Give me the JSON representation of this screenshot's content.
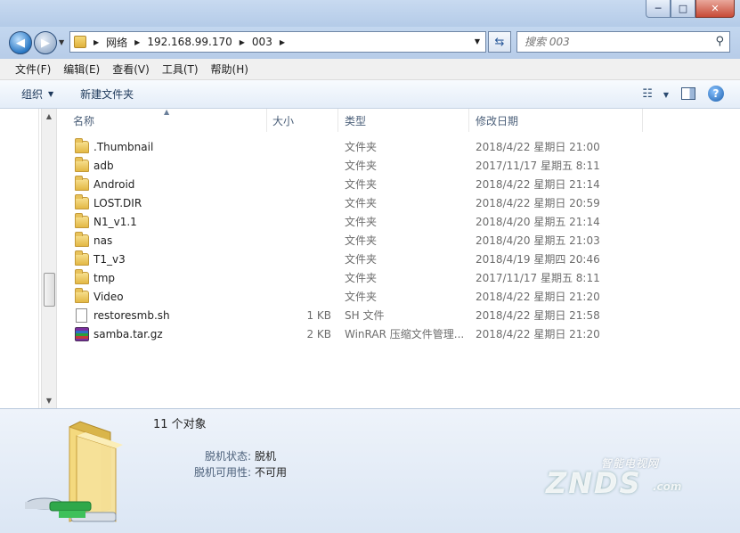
{
  "window": {
    "minimize_glyph": "─",
    "maximize_glyph": "□",
    "close_glyph": "✕"
  },
  "address": {
    "crumbs": [
      "网络",
      "192.168.99.170",
      "003"
    ]
  },
  "search": {
    "placeholder": "搜索 003"
  },
  "menu": [
    "文件(F)",
    "编辑(E)",
    "查看(V)",
    "工具(T)",
    "帮助(H)"
  ],
  "toolbar": {
    "organize": "组织",
    "new_folder": "新建文件夹"
  },
  "columns": {
    "name": "名称",
    "size": "大小",
    "type": "类型",
    "date": "修改日期"
  },
  "files": [
    {
      "name": ".Thumbnail",
      "size": "",
      "type": "文件夹",
      "date": "2018/4/22 星期日 21:00",
      "icon": "folder-icon"
    },
    {
      "name": "adb",
      "size": "",
      "type": "文件夹",
      "date": "2017/11/17 星期五 8:11",
      "icon": "folder-icon"
    },
    {
      "name": "Android",
      "size": "",
      "type": "文件夹",
      "date": "2018/4/22 星期日 21:14",
      "icon": "folder-icon"
    },
    {
      "name": "LOST.DIR",
      "size": "",
      "type": "文件夹",
      "date": "2018/4/22 星期日 20:59",
      "icon": "folder-icon"
    },
    {
      "name": "N1_v1.1",
      "size": "",
      "type": "文件夹",
      "date": "2018/4/20 星期五 21:14",
      "icon": "folder-icon"
    },
    {
      "name": "nas",
      "size": "",
      "type": "文件夹",
      "date": "2018/4/20 星期五 21:03",
      "icon": "folder-icon"
    },
    {
      "name": "T1_v3",
      "size": "",
      "type": "文件夹",
      "date": "2018/4/19 星期四 20:46",
      "icon": "folder-icon"
    },
    {
      "name": "tmp",
      "size": "",
      "type": "文件夹",
      "date": "2017/11/17 星期五 8:11",
      "icon": "folder-icon"
    },
    {
      "name": "Video",
      "size": "",
      "type": "文件夹",
      "date": "2018/4/22 星期日 21:20",
      "icon": "folder-icon"
    },
    {
      "name": "restoresmb.sh",
      "size": "1 KB",
      "type": "SH 文件",
      "date": "2018/4/22 星期日 21:58",
      "icon": "file-icon"
    },
    {
      "name": "samba.tar.gz",
      "size": "2 KB",
      "type": "WinRAR 压缩文件管理...",
      "date": "2018/4/22 星期日 21:20",
      "icon": "winrar-icon"
    }
  ],
  "details": {
    "count": "11 个对象",
    "offline_status_label": "脱机状态:",
    "offline_status_value": "脱机",
    "offline_avail_label": "脱机可用性:",
    "offline_avail_value": "不可用"
  },
  "watermark": {
    "top": "智能电视网",
    "main": "ZNDS",
    "suffix": ".com"
  }
}
